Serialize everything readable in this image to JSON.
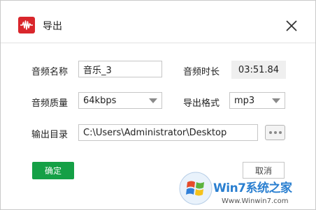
{
  "dialog": {
    "title": "导出",
    "close_icon": "close-icon",
    "app_icon": "waveform-icon",
    "accent_color": "#d9262c"
  },
  "form": {
    "name_label": "音频名称",
    "name_value": "音乐_3",
    "duration_label": "音频时长",
    "duration_value": "03:51.84",
    "quality_label": "音频质量",
    "quality_value": "64kbps",
    "format_label": "导出格式",
    "format_value": "mp3",
    "dir_label": "输出目录",
    "dir_value": "C:\\Users\\Administrator\\Desktop",
    "browse_icon": "ellipsis-icon"
  },
  "buttons": {
    "ok_label": "确定",
    "ok_color": "#15a046",
    "cancel_label": "取消"
  },
  "watermark": {
    "brand": "Win7系统之家",
    "url": "Www.Winwin7.com"
  }
}
